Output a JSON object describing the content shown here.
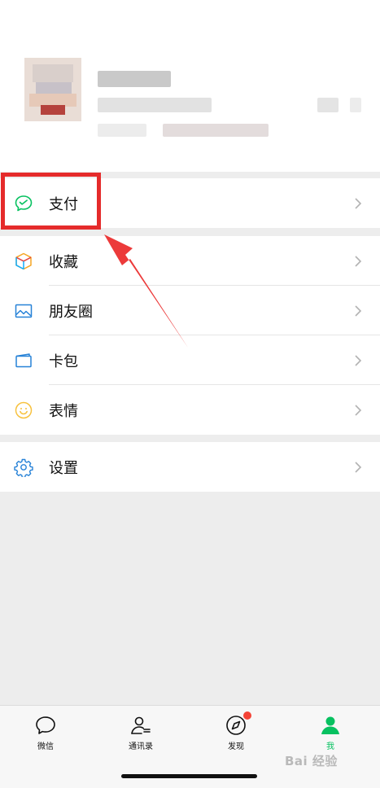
{
  "menu": {
    "pay": "支付",
    "favorites": "收藏",
    "moments": "朋友圈",
    "cards": "卡包",
    "stickers": "表情",
    "settings": "设置"
  },
  "tabs": {
    "chats": "微信",
    "contacts": "通讯录",
    "discover": "发现",
    "me": "我"
  },
  "icons": {
    "pay": "wechat-pay-icon",
    "favorites": "favorites-cube-icon",
    "moments": "moments-photo-icon",
    "cards": "card-wallet-icon",
    "stickers": "smiley-icon",
    "settings": "gear-icon",
    "chevron": "chevron-right-icon",
    "chats": "chat-bubble-icon",
    "contacts": "contacts-icon",
    "discover": "compass-icon",
    "me": "person-icon"
  },
  "watermark": "Bai 经验",
  "colors": {
    "accent_green": "#07c160",
    "highlight_red": "#e52b2b",
    "badge_red": "#f44336"
  }
}
